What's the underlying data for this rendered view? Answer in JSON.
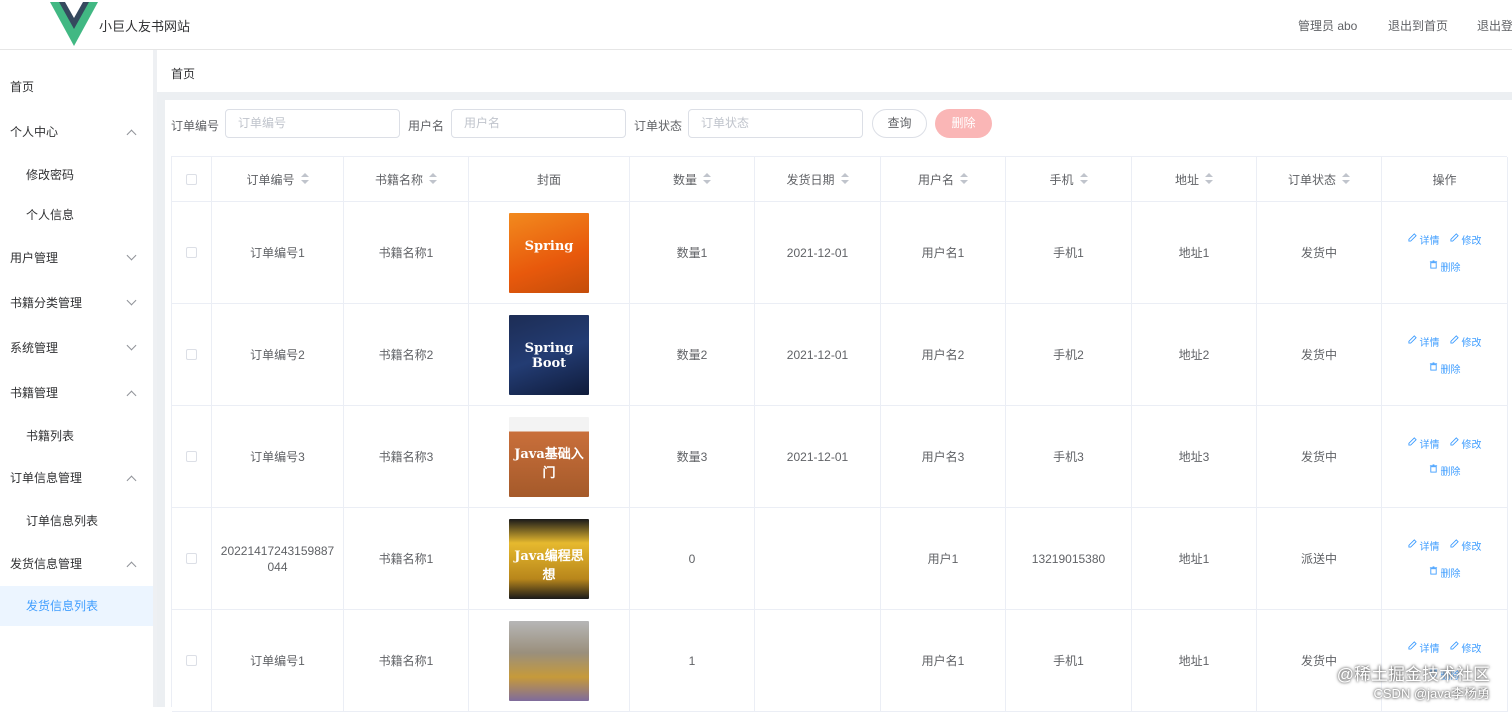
{
  "header": {
    "site_title": "小巨人友书网站",
    "admin_label": "管理员 abo",
    "back_home": "退出到首页",
    "logout": "退出登"
  },
  "sidebar": {
    "items": [
      {
        "label": "首页",
        "type": "top",
        "chevron": ""
      },
      {
        "label": "个人中心",
        "type": "top",
        "chevron": "up"
      },
      {
        "label": "修改密码",
        "type": "sub",
        "chevron": ""
      },
      {
        "label": "个人信息",
        "type": "sub",
        "chevron": ""
      },
      {
        "label": "用户管理",
        "type": "top",
        "chevron": "down"
      },
      {
        "label": "书籍分类管理",
        "type": "top",
        "chevron": "down"
      },
      {
        "label": "系统管理",
        "type": "top",
        "chevron": "down"
      },
      {
        "label": "书籍管理",
        "type": "top",
        "chevron": "up"
      },
      {
        "label": "书籍列表",
        "type": "sub",
        "chevron": ""
      },
      {
        "label": "订单信息管理",
        "type": "top",
        "chevron": "up"
      },
      {
        "label": "订单信息列表",
        "type": "sub",
        "chevron": ""
      },
      {
        "label": "发货信息管理",
        "type": "top",
        "chevron": "up"
      },
      {
        "label": "发货信息列表",
        "type": "sub",
        "chevron": "",
        "active": true
      }
    ]
  },
  "breadcrumb": "首页",
  "search": {
    "order_no_label": "订单编号",
    "order_no_placeholder": "订单编号",
    "username_label": "用户名",
    "username_placeholder": "用户名",
    "status_label": "订单状态",
    "status_placeholder": "订单状态",
    "query_button": "查询",
    "delete_button": "删除"
  },
  "table": {
    "columns": [
      "订单编号",
      "书籍名称",
      "封面",
      "数量",
      "发货日期",
      "用户名",
      "手机",
      "地址",
      "订单状态",
      "操作"
    ],
    "rows": [
      {
        "order_no": "订单编号1",
        "book": "书籍名称1",
        "cover": "spring-orange",
        "cover_text": "Spring",
        "qty": "数量1",
        "date": "2021-12-01",
        "user": "用户名1",
        "phone": "手机1",
        "addr": "地址1",
        "status": "发货中"
      },
      {
        "order_no": "订单编号2",
        "book": "书籍名称2",
        "cover": "springboot-blue",
        "cover_text": "Spring Boot",
        "qty": "数量2",
        "date": "2021-12-01",
        "user": "用户名2",
        "phone": "手机2",
        "addr": "地址2",
        "status": "发货中"
      },
      {
        "order_no": "订单编号3",
        "book": "书籍名称3",
        "cover": "java-brown",
        "cover_text": "Java基础入门",
        "qty": "数量3",
        "date": "2021-12-01",
        "user": "用户名3",
        "phone": "手机3",
        "addr": "地址3",
        "status": "发货中"
      },
      {
        "order_no": "20221417243159887044",
        "book": "书籍名称1",
        "cover": "java-yellow",
        "cover_text": "Java编程思想",
        "qty": "0",
        "date": "",
        "user": "用户1",
        "phone": "13219015380",
        "addr": "地址1",
        "status": "派送中"
      },
      {
        "order_no": "订单编号1",
        "book": "书籍名称1",
        "cover": "pattern-gray",
        "cover_text": "",
        "qty": "1",
        "date": "",
        "user": "用户名1",
        "phone": "手机1",
        "addr": "地址1",
        "status": "发货中"
      }
    ],
    "op_detail": "详情",
    "op_edit": "修改",
    "op_delete": "删除"
  },
  "watermark": {
    "line1": "@稀土掘金技术社区",
    "line2": "CSDN @java李杨勇"
  }
}
